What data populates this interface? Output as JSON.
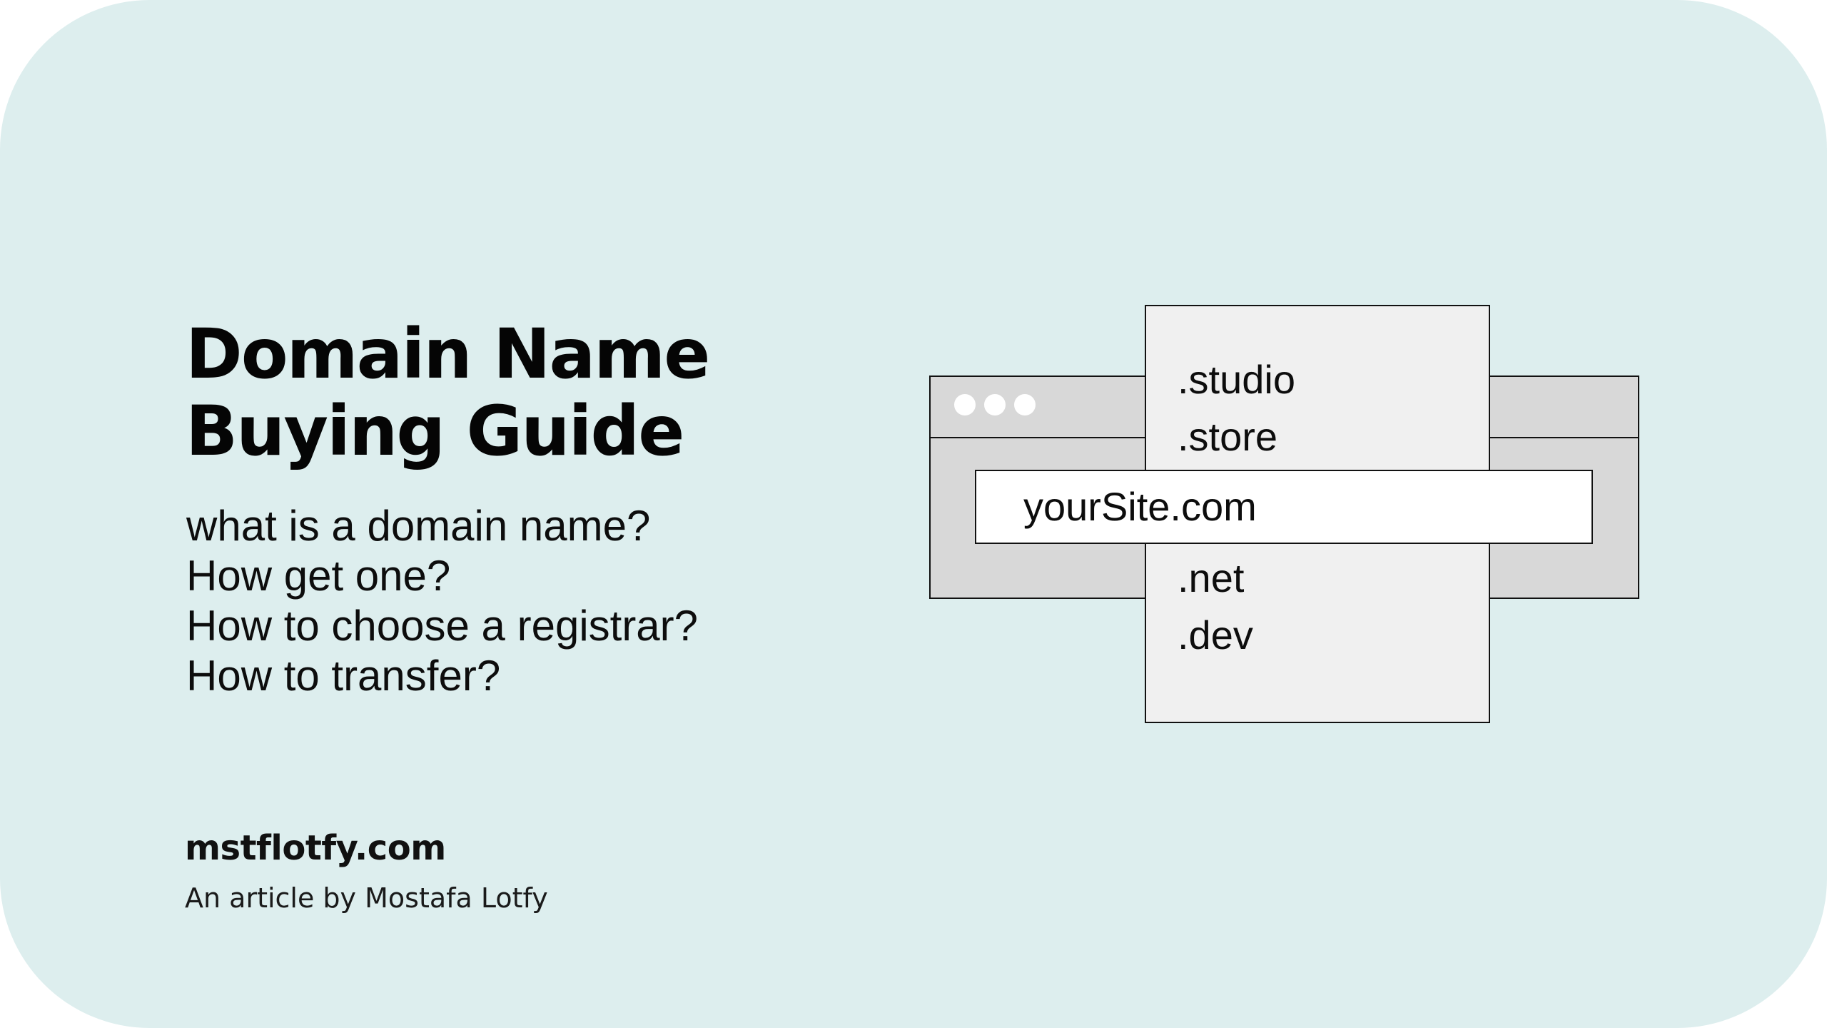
{
  "colors": {
    "background": "#ddeeee",
    "text": "#0a0a0a",
    "window_frame": "#d8d8d8",
    "dropdown_panel": "#f0f0f0",
    "address_bar": "#ffffff",
    "border": "#111111"
  },
  "title": {
    "line1": "Domain Name",
    "line2": "Buying Guide"
  },
  "questions": [
    "what is a domain name?",
    "How get one?",
    "How to choose a registrar?",
    "How to transfer?"
  ],
  "footer": {
    "site": "mstflotfy.com",
    "byline": "An article by Mostafa Lotfy"
  },
  "illustration": {
    "address_value": "yourSite.com",
    "tld_options": [
      ".studio",
      ".store",
      ".net",
      ".dev"
    ],
    "window_controls": [
      "dot",
      "dot",
      "dot"
    ]
  }
}
